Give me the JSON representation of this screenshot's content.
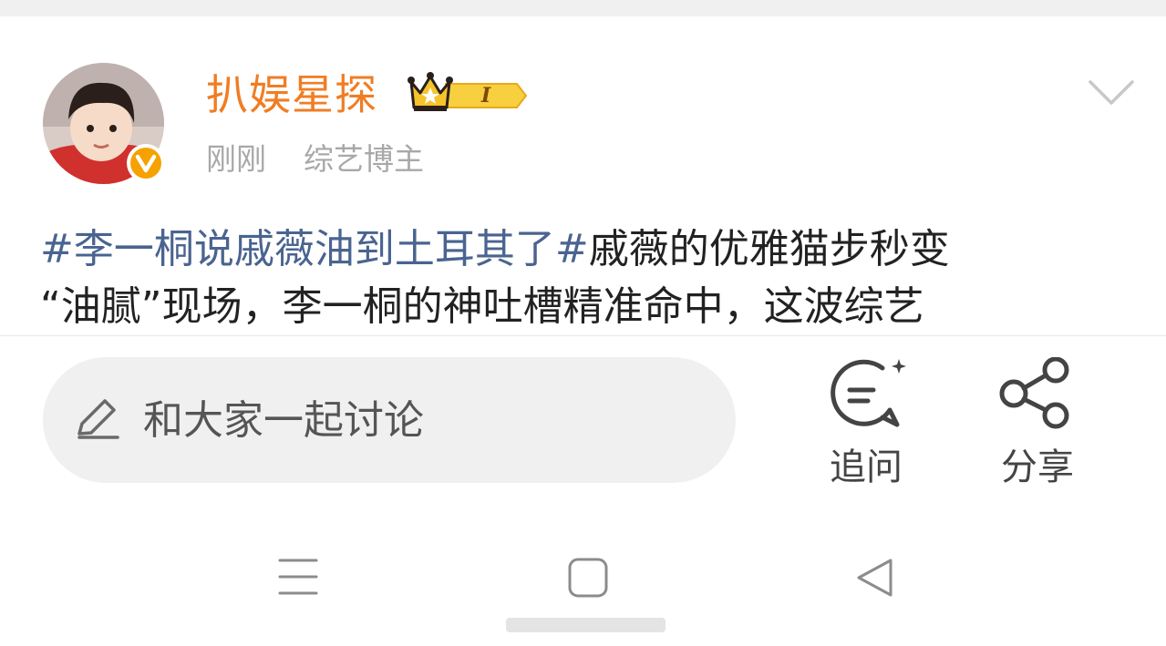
{
  "post": {
    "username": "扒娱星探",
    "level_badge": "I",
    "time": "刚刚",
    "source": "综艺博主",
    "hashtag": "#李一桐说戚薇油到土耳其了#",
    "text_line1": "戚薇的优雅猫步秒变",
    "text_line2": "“油腻”现场，李一桐的神吐槽精准命中，这波综艺"
  },
  "comment": {
    "placeholder": "和大家一起讨论"
  },
  "actions": {
    "ask_label": "追问",
    "share_label": "分享"
  },
  "colors": {
    "username": "#f07d24",
    "hashtag": "#4a6490",
    "verified_badge": "#f5a200",
    "crown": "#f6c42a"
  },
  "icons": [
    "verified-badge-icon",
    "crown-level-icon",
    "chevron-down-icon",
    "pencil-icon",
    "comment-bubble-icon",
    "share-icon",
    "menu-icon",
    "home-square-icon",
    "back-triangle-icon"
  ]
}
